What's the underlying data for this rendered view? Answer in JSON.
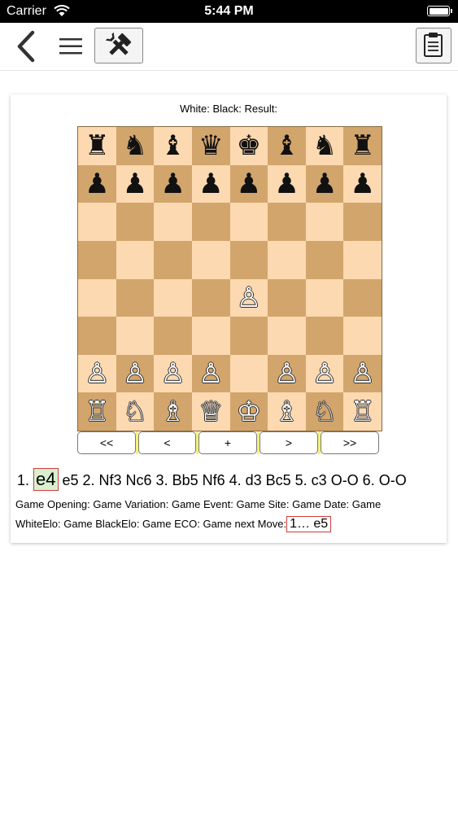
{
  "status_bar": {
    "carrier": "Carrier",
    "time": "5:44 PM"
  },
  "toolbar": {
    "icons": [
      "chevron-left-icon",
      "hamburger-menu-icon",
      "tools-icon",
      "clipboard-icon"
    ]
  },
  "game": {
    "header": "White:  Black:  Result:",
    "board": [
      [
        "♜",
        "♞",
        "♝",
        "♛",
        "♚",
        "♝",
        "♞",
        "♜"
      ],
      [
        "♟",
        "♟",
        "♟",
        "♟",
        "♟",
        "♟",
        "♟",
        "♟"
      ],
      [
        "",
        "",
        "",
        "",
        "",
        "",
        "",
        ""
      ],
      [
        "",
        "",
        "",
        "",
        "",
        "",
        "",
        ""
      ],
      [
        "",
        "",
        "",
        "",
        "♙",
        "",
        "",
        ""
      ],
      [
        "",
        "",
        "",
        "",
        "",
        "",
        "",
        ""
      ],
      [
        "♙",
        "♙",
        "♙",
        "♙",
        "",
        "♙",
        "♙",
        "♙"
      ],
      [
        "♖",
        "♘",
        "♗",
        "♕",
        "♔",
        "♗",
        "♘",
        "♖"
      ]
    ],
    "colors": {
      "light_square": "#fcd9b0",
      "dark_square": "#d2a56c",
      "highlight_border": "#d43b3b",
      "highlight_bg": "#d8f0d0"
    },
    "nav": {
      "first": "<<",
      "prev": "<",
      "add": "+",
      "next": ">",
      "last": ">>"
    },
    "moves": {
      "prefix": "1. ",
      "current": "e4",
      "rest": " e5 2. Nf3 Nc6 3. Bb5 Nf6 4. d3 Bc5 5. c3 O-O 6. O-O"
    },
    "info": {
      "line1": "Game Opening:   Game Variation: Game Event: Game Site: Game Date: Game",
      "line2": "WhiteElo: Game BlackElo: Game ECO: Game next Move:",
      "next_move": "1… e5"
    }
  }
}
